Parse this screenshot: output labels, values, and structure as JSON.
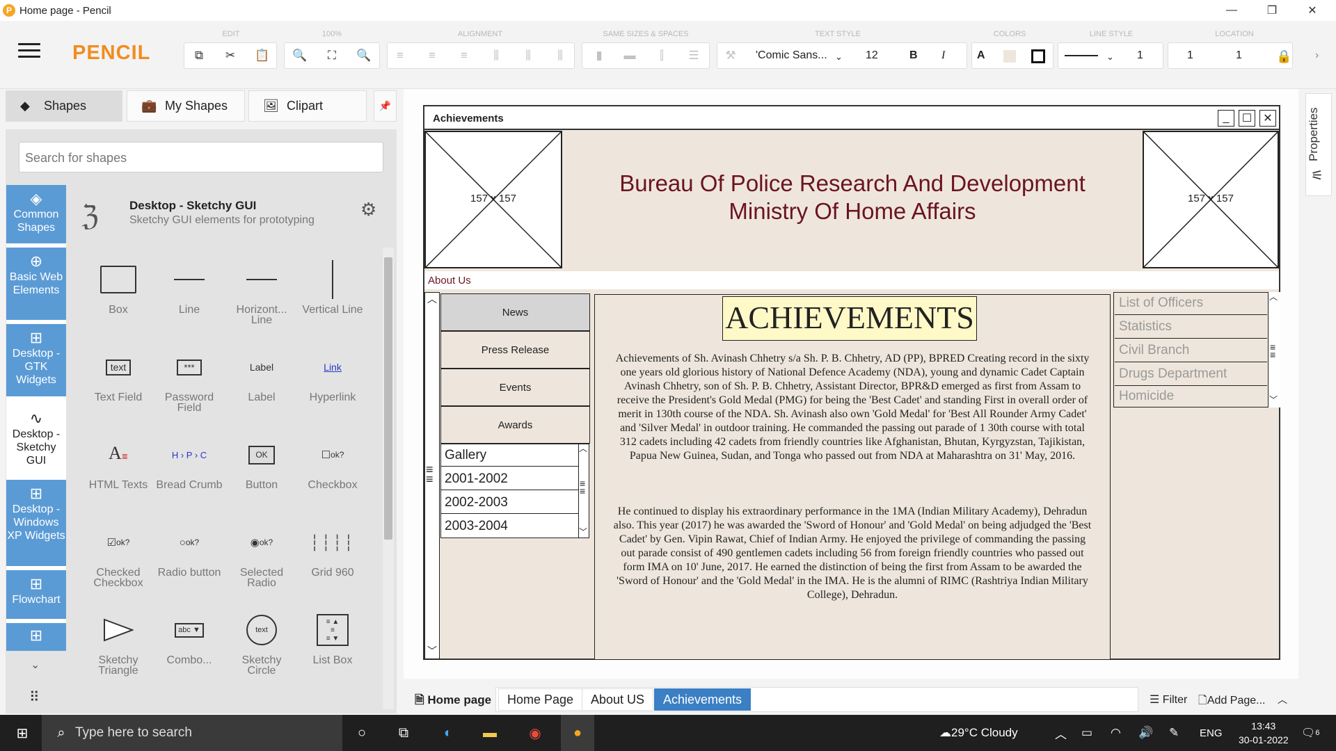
{
  "window": {
    "title": "Home page - Pencil",
    "minimize": "—",
    "restore": "❐",
    "close": "✕"
  },
  "toolbar": {
    "brand": "PENCIL",
    "groups": [
      "EDIT",
      "100%",
      "ALIGNMENT",
      "SAME SIZES & SPACES",
      "TEXT STYLE",
      "COLORS",
      "LINE STYLE",
      "LOCATION"
    ],
    "font_family": "'Comic Sans...",
    "font_size": "12",
    "bold": "B",
    "italic": "I",
    "text_color": "A",
    "line_width": "1",
    "loc_x": "1",
    "loc_y": "1"
  },
  "panel": {
    "tabs": [
      "Shapes",
      "My Shapes",
      "Clipart"
    ],
    "search_placeholder": "Search for shapes",
    "categories": [
      "Common Shapes",
      "Basic Web Elements",
      "Desktop - GTK Widgets",
      "Desktop - Sketchy GUI",
      "Desktop - Windows XP Widgets",
      "Flowchart"
    ],
    "collection_title": "Desktop - Sketchy GUI",
    "collection_desc": "Sketchy GUI elements for prototyping",
    "shapes": [
      "Box",
      "Line",
      "Horizont... Line",
      "Vertical Line",
      "Text Field",
      "Password Field",
      "Label",
      "Hyperlink",
      "HTML Texts",
      "Bread Crumb",
      "Button",
      "Checkbox",
      "Checked Checkbox",
      "Radio button",
      "Selected Radio",
      "Grid 960",
      "Sketchy Triangle",
      "Combo...",
      "Sketchy Circle",
      "List Box"
    ],
    "shape_glyphs": {
      "text_field": "text",
      "password": "***",
      "label": "Label",
      "link": "Link",
      "button": "OK",
      "ok": "ok?",
      "breadcrumb": "H › P › C",
      "combo": "abc",
      "circle": "text"
    }
  },
  "canvas": {
    "window_title": "Achievements",
    "img_left": "157 x 157",
    "img_right": "157 x 157",
    "header_line1": "Bureau Of Police Research And Development",
    "header_line2": "Ministry Of Home Affairs",
    "about": "About Us",
    "menu": [
      "News",
      "Press Release",
      "Events",
      "Awards"
    ],
    "gallery": [
      "Gallery",
      "2001-2002",
      "2002-2003",
      "2003-2004"
    ],
    "heading": "ACHIEVEMENTS",
    "para1": "Achievements of Sh. Avinash Chhetry s/a Sh. P. B. Chhetry, AD (PP), BPRED Creating record in the sixty one years old glorious history of National Defence Academy (NDA), young and dynamic Cadet Captain Avinash Chhetry, son of Sh. P. B. Chhetry, Assistant Director, BPR&D emerged as first from Assam to receive the President's Gold Medal (PMG) for being the 'Best Cadet' and standing First in overall order of merit in 130th course of the NDA. Sh. Avinash also own 'Gold Medal' for 'Best All Rounder Army Cadet' and 'Silver Medal' in outdoor training. He commanded the passing out parade of 1 30th course with total 312 cadets including 42 cadets from friendly countries like Afghanistan, Bhutan, Kyrgyzstan, Tajikistan, Papua New Guinea, Sudan, and Tonga who passed out from NDA at Maharashtra on 31' May, 2016.",
    "para2": "He continued to display his extraordinary performance in the 1MA (Indian Military Academy), Dehradun also. This year (2017) he was awarded the 'Sword of Honour' and 'Gold Medal' on being adjudged the 'Best Cadet' by Gen. Vipin Rawat, Chief of Indian Army. He enjoyed the privilege of commanding the passing out parade consist of 490 gentlemen cadets including 56 from foreign friendly countries who passed out form IMA on 10' June, 2017. He earned the distinction of being the first from Assam to be awarded the 'Sword of Honour' and the 'Gold Medal' in the IMA. He is the alumni of RIMC (Rashtriya Indian Military College), Dehradun.",
    "right_list": [
      "List of Officers",
      "Statistics",
      "Civil Branch",
      "Drugs Department",
      "Homicide"
    ]
  },
  "properties_label": "Properties",
  "pages": {
    "doc": "Home page",
    "tabs": [
      "Home Page",
      "About US",
      "Achievements"
    ],
    "filter": "Filter",
    "add": "Add Page..."
  },
  "taskbar": {
    "search": "Type here to search",
    "weather": "29°C  Cloudy",
    "lang": "ENG",
    "time": "13:43",
    "date": "30-01-2022",
    "notif": "6"
  }
}
